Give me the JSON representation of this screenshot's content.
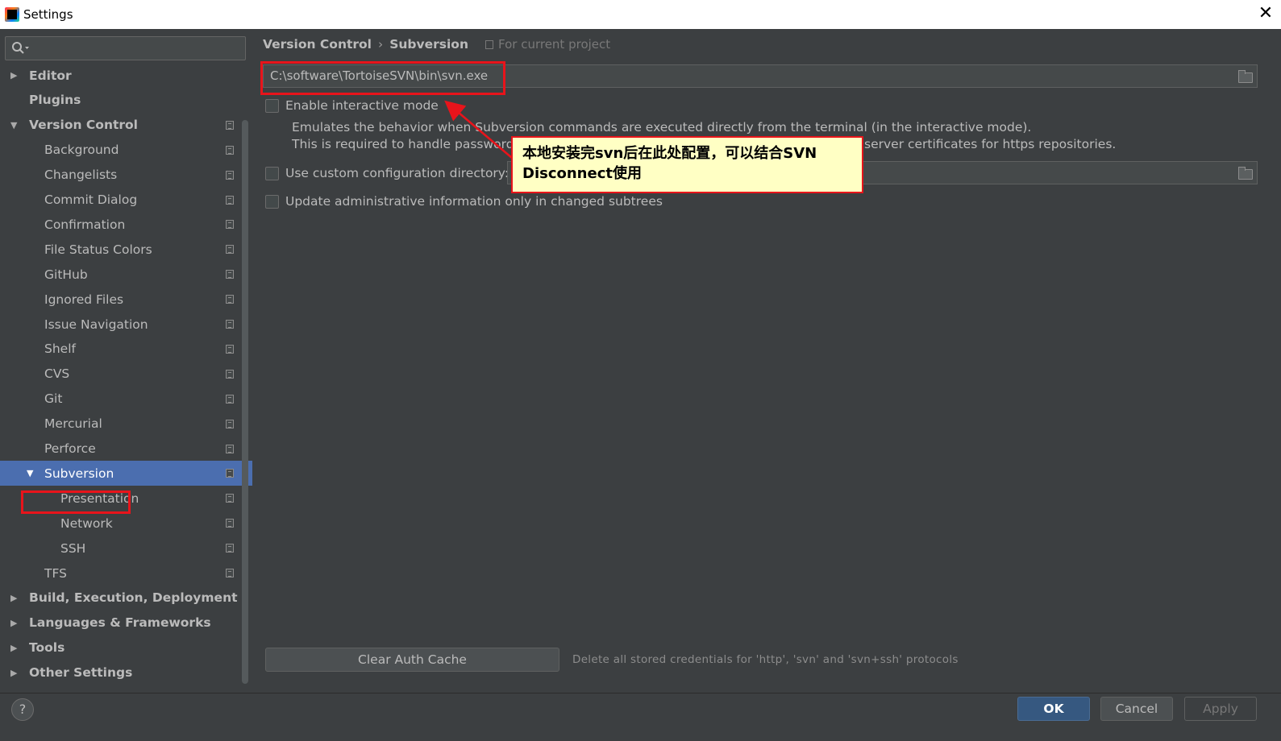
{
  "window": {
    "title": "Settings",
    "close_glyph": "✕"
  },
  "search": {
    "placeholder": ""
  },
  "tree": [
    {
      "label": "Editor",
      "level": 0,
      "bold": true,
      "arrow": "▶",
      "proj": false
    },
    {
      "label": "Plugins",
      "level": 0,
      "bold": true,
      "arrow": "",
      "proj": false
    },
    {
      "label": "Version Control",
      "level": 0,
      "bold": true,
      "arrow": "▼",
      "proj": true
    },
    {
      "label": "Background",
      "level": 1,
      "proj": true
    },
    {
      "label": "Changelists",
      "level": 1,
      "proj": true
    },
    {
      "label": "Commit Dialog",
      "level": 1,
      "proj": true
    },
    {
      "label": "Confirmation",
      "level": 1,
      "proj": true
    },
    {
      "label": "File Status Colors",
      "level": 1,
      "proj": true
    },
    {
      "label": "GitHub",
      "level": 1,
      "proj": true
    },
    {
      "label": "Ignored Files",
      "level": 1,
      "proj": true
    },
    {
      "label": "Issue Navigation",
      "level": 1,
      "proj": true
    },
    {
      "label": "Shelf",
      "level": 1,
      "proj": true
    },
    {
      "label": "CVS",
      "level": 1,
      "proj": true
    },
    {
      "label": "Git",
      "level": 1,
      "proj": true
    },
    {
      "label": "Mercurial",
      "level": 1,
      "proj": true
    },
    {
      "label": "Perforce",
      "level": 1,
      "proj": true
    },
    {
      "label": "Subversion",
      "level": 1,
      "arrow": "▼",
      "selected": true,
      "proj": true
    },
    {
      "label": "Presentation",
      "level": 2,
      "proj": true
    },
    {
      "label": "Network",
      "level": 2,
      "proj": true
    },
    {
      "label": "SSH",
      "level": 2,
      "proj": true
    },
    {
      "label": "TFS",
      "level": 1,
      "proj": true
    },
    {
      "label": "Build, Execution, Deployment",
      "level": 0,
      "bold": true,
      "arrow": "▶",
      "proj": false
    },
    {
      "label": "Languages & Frameworks",
      "level": 0,
      "bold": true,
      "arrow": "▶",
      "proj": false
    },
    {
      "label": "Tools",
      "level": 0,
      "bold": true,
      "arrow": "▶",
      "proj": false
    },
    {
      "label": "Other Settings",
      "level": 0,
      "bold": true,
      "arrow": "▶",
      "proj": false
    }
  ],
  "breadcrumb": {
    "parent": "Version Control",
    "separator": "›",
    "current": "Subversion"
  },
  "for_current_project": "For current project",
  "svn_path": "C:\\software\\TortoiseSVN\\bin\\svn.exe",
  "options": {
    "interactive_mode": "Enable interactive mode",
    "interactive_desc_1": "Emulates the behavior when Subversion commands are executed directly from the terminal (in the interactive mode).",
    "interactive_desc_2_left": "This is required to handle password/p",
    "interactive_desc_2_right": "server certificates for https repositories.",
    "custom_config": "Use custom configuration directory:",
    "update_admin": "Update administrative information only in changed subtrees"
  },
  "annotation": {
    "text": "本地安装完svn后在此处配置，可以结合SVN Disconnect使用"
  },
  "clear_auth": {
    "label": "Clear Auth Cache",
    "note": "Delete all stored credentials for 'http', 'svn' and 'svn+ssh' protocols"
  },
  "footer": {
    "help": "?",
    "ok": "OK",
    "cancel": "Cancel",
    "apply": "Apply"
  },
  "colors": {
    "selection": "#4b6eaf",
    "annotation_border": "#e8141b",
    "annotation_bg": "#ffffc4",
    "ok_button": "#365880"
  }
}
